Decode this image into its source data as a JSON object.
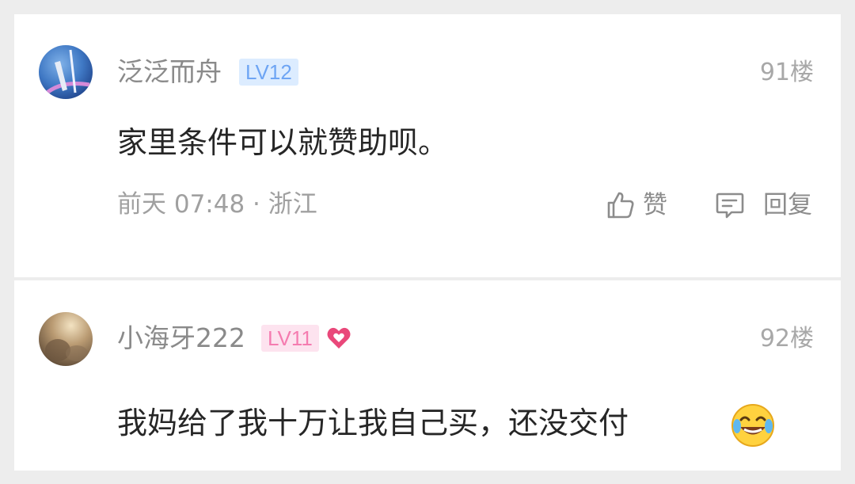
{
  "comments": [
    {
      "username": "泛泛而舟",
      "level": "LV12",
      "floor": "91楼",
      "content": "家里条件可以就赞助呗。",
      "meta": "前天 07:48 · 浙江",
      "like_label": "赞",
      "reply_label": "回复"
    },
    {
      "username": "小海牙222",
      "level": "LV11",
      "floor": "92楼",
      "content": "我妈给了我十万让我自己买，还没交付"
    }
  ],
  "colors": {
    "level_blue": "#6ea5f4",
    "level_pink": "#f57cb0",
    "heart": "#e9487a"
  },
  "icons": [
    "thumbs-up-icon",
    "comment-icon",
    "heart-icon",
    "laughing-tears-emoji"
  ]
}
